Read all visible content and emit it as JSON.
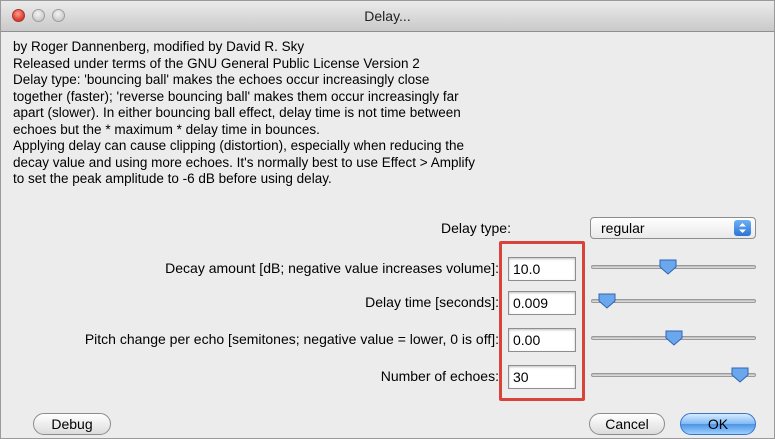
{
  "window": {
    "title": "Delay..."
  },
  "description": [
    "by Roger Dannenberg, modified by David R. Sky",
    "Released under terms of the GNU General Public License Version 2",
    "Delay type: 'bouncing ball' makes the echoes occur increasingly close",
    "together (faster); 'reverse bouncing ball' makes them occur increasingly far",
    "apart (slower). In either bouncing ball effect, delay time is not time between",
    "echoes but the * maximum * delay time in bounces.",
    "Applying delay can cause clipping (distortion), especially when reducing the",
    "decay value and using more echoes. It's normally best to use Effect > Amplify",
    "to set the peak amplitude to -6 dB before using delay."
  ],
  "delay_type": {
    "label": "Delay type:",
    "value": "regular"
  },
  "controls": [
    {
      "label": "Decay amount [dB; negative value increases volume]:",
      "value": "10.0",
      "slider_fraction": 0.46
    },
    {
      "label": "Delay time [seconds]:",
      "value": "0.009",
      "slider_fraction": 0.05
    },
    {
      "label": "Pitch change per echo [semitones; negative value = lower, 0 is off]:",
      "value": "0.00",
      "slider_fraction": 0.5
    },
    {
      "label": "Number of echoes:",
      "value": "30",
      "slider_fraction": 0.95
    }
  ],
  "buttons": {
    "debug": "Debug",
    "cancel": "Cancel",
    "ok": "OK"
  },
  "colors": {
    "highlight": "#d8433a",
    "accent": "#4c94e6"
  }
}
